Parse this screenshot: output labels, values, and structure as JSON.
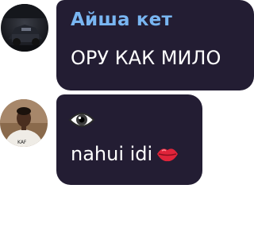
{
  "messages": [
    {
      "sender": "Айша кет",
      "text": "ОРУ КАК МИЛО",
      "avatar": "avatar-dark-night"
    },
    {
      "sender_emoji": "eye-emoji",
      "text": "nahui idi",
      "trailing_emoji": "kiss-lips-emoji",
      "avatar": "avatar-person-white-shirt"
    }
  ],
  "colors": {
    "bubble": "#231d33",
    "sender_name": "#79b6f2",
    "text": "#ffffff",
    "background": "#ffffff"
  }
}
